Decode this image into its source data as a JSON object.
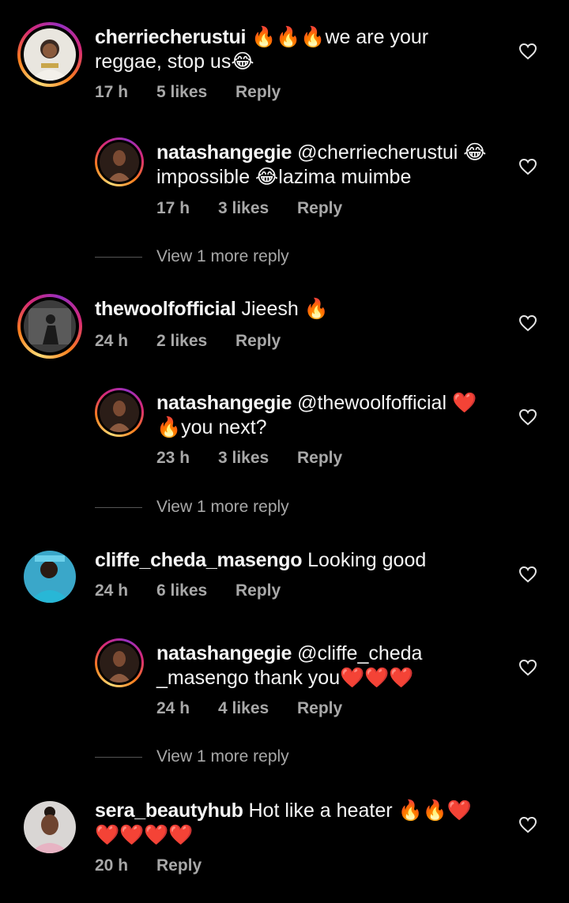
{
  "comments": [
    {
      "username": "cherriecherustui",
      "text_line1": "🔥🔥🔥we are your",
      "text_line2": "reggae, stop us😂",
      "time": "17 h",
      "likes": "5 likes",
      "reply": "Reply"
    },
    {
      "username": "natashangegie",
      "text_line1": "@cherriecherustui 😂",
      "text_line2": "impossible 😂lazima muimbe",
      "time": "17 h",
      "likes": "3 likes",
      "reply": "Reply"
    },
    {
      "username": "thewoolfofficial",
      "text_line1": "Jieesh 🔥",
      "time": "24 h",
      "likes": "2 likes",
      "reply": "Reply"
    },
    {
      "username": "natashangegie",
      "text_line1": "@thewoolfofficial ❤️",
      "text_line2": "🔥you next?",
      "time": "23 h",
      "likes": "3 likes",
      "reply": "Reply"
    },
    {
      "username": "cliffe_cheda_masengo",
      "text_line1": "Looking good",
      "time": "24 h",
      "likes": "6 likes",
      "reply": "Reply"
    },
    {
      "username": "natashangegie",
      "text_line1": "@cliffe_cheda",
      "text_line2": "_masengo thank you❤️❤️❤️",
      "time": "24 h",
      "likes": "4 likes",
      "reply": "Reply"
    },
    {
      "username": "sera_beautyhub",
      "text_line1": "Hot like a heater 🔥🔥❤️",
      "text_line2": "❤️❤️❤️❤️",
      "time": "20 h",
      "reply": "Reply"
    }
  ],
  "view_more": [
    "View 1 more reply",
    "View 1 more reply",
    "View 1 more reply"
  ],
  "icons": {
    "like": "heart-outline-icon"
  },
  "colors": {
    "background": "#000000",
    "text": "#f5f5f5",
    "meta": "#a8a8a8"
  }
}
